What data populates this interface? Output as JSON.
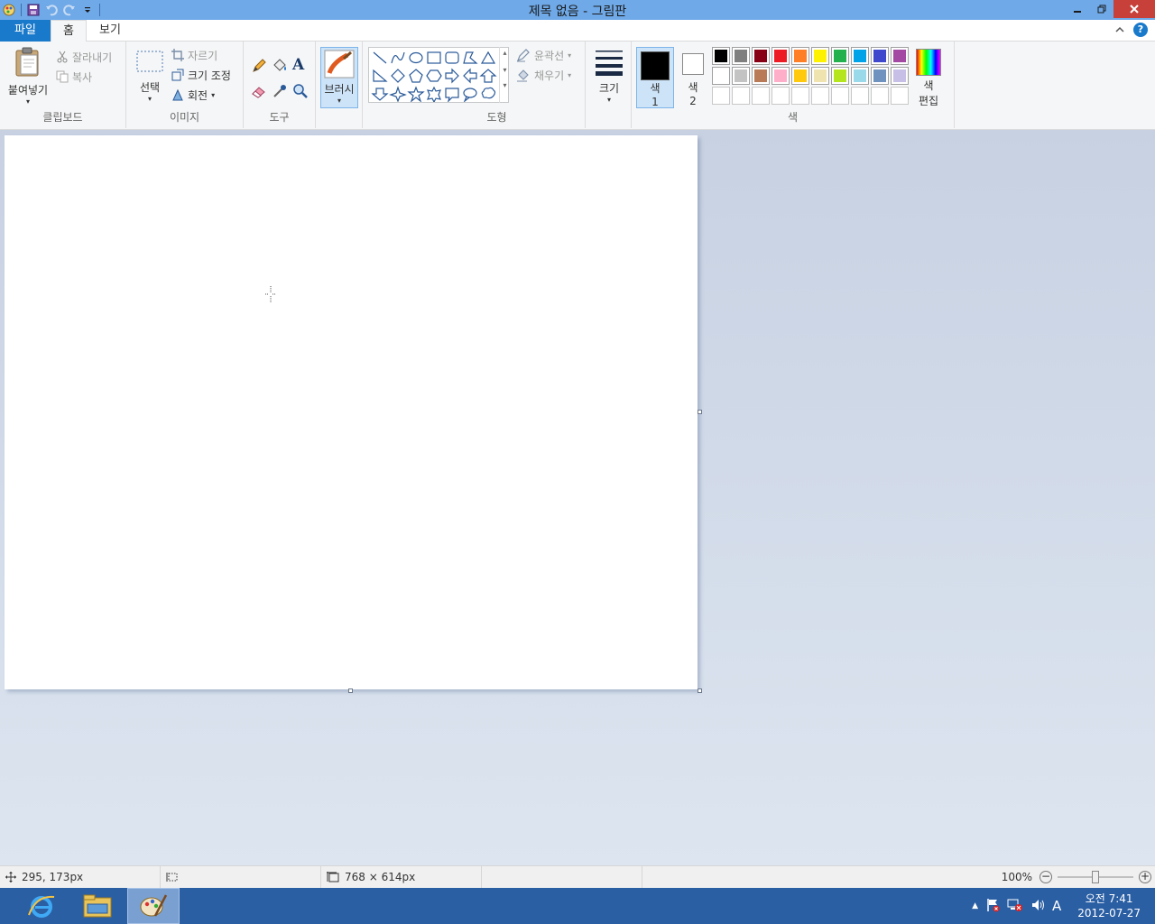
{
  "window": {
    "title": "제목 없음 - 그림판"
  },
  "tabs": {
    "file": "파일",
    "home": "홈",
    "view": "보기"
  },
  "clipboard": {
    "paste": "붙여넣기",
    "cut": "잘라내기",
    "copy": "복사",
    "label": "클립보드"
  },
  "image": {
    "select": "선택",
    "crop": "자르기",
    "resize": "크기 조정",
    "rotate": "회전",
    "label": "이미지"
  },
  "tools": {
    "label": "도구"
  },
  "brush": {
    "label": "브러시"
  },
  "shapes": {
    "outline": "윤곽선",
    "fill": "채우기",
    "label": "도형"
  },
  "size": {
    "label": "크기"
  },
  "colors": {
    "color1_a": "색",
    "color1_b": "1",
    "color2_a": "색",
    "color2_b": "2",
    "edit_a": "색",
    "edit_b": "편집",
    "label": "색",
    "color1": "#000000",
    "color2": "#ffffff",
    "palette_row1": [
      "#000000",
      "#7f7f7f",
      "#880015",
      "#ed1c24",
      "#ff7f27",
      "#fff200",
      "#22b14c",
      "#00a2e8",
      "#3f48cc",
      "#a349a4"
    ],
    "palette_row2": [
      "#ffffff",
      "#c3c3c3",
      "#b97a57",
      "#ffaec9",
      "#ffc90e",
      "#efe4b0",
      "#b5e61d",
      "#99d9ea",
      "#7092be",
      "#c8bfe7"
    ]
  },
  "status": {
    "cursor_pos": "295, 173px",
    "canvas_size": "768 × 614px",
    "zoom": "100%"
  },
  "taskbar": {
    "time": "오전 7:41",
    "date": "2012-07-27",
    "ime": "A"
  }
}
